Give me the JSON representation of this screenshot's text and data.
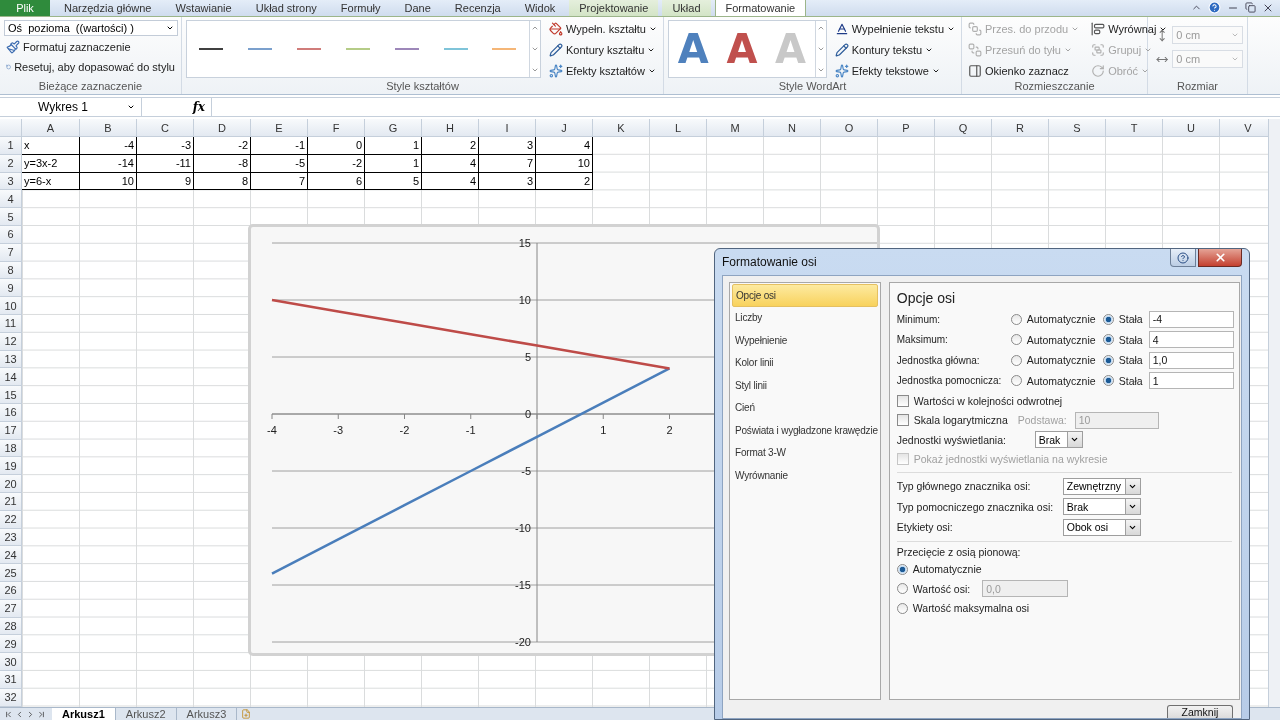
{
  "ribbon_tabs": [
    {
      "label": "Plik",
      "kind": "file",
      "selected": false
    },
    {
      "label": "Narzędzia główne",
      "kind": "normal",
      "selected": false
    },
    {
      "label": "Wstawianie",
      "kind": "normal",
      "selected": false
    },
    {
      "label": "Układ strony",
      "kind": "normal",
      "selected": false
    },
    {
      "label": "Formuły",
      "kind": "normal",
      "selected": false
    },
    {
      "label": "Dane",
      "kind": "normal",
      "selected": false
    },
    {
      "label": "Recenzja",
      "kind": "normal",
      "selected": false
    },
    {
      "label": "Widok",
      "kind": "normal",
      "selected": false
    },
    {
      "label": "Projektowanie",
      "kind": "contextual",
      "selected": false
    },
    {
      "label": "Układ",
      "kind": "contextual",
      "selected": false
    },
    {
      "label": "Formatowanie",
      "kind": "contextual",
      "selected": true
    }
  ],
  "ribbon": {
    "current_selection": {
      "label": "Bieżące zaznaczenie",
      "dropdown": "Oś  pozioma  ((wartości) )",
      "buttons": [
        {
          "label": "Formatuj zaznaczenie"
        },
        {
          "label": "Resetuj, aby dopasować do stylu"
        }
      ]
    },
    "shape_styles": {
      "label": "Style kształtów",
      "swatches": [
        {
          "color": "#404040"
        },
        {
          "color": "#7ba0cd"
        },
        {
          "color": "#d07c7a"
        },
        {
          "color": "#b5cc87"
        },
        {
          "color": "#9d87b9"
        },
        {
          "color": "#7fc4d9"
        },
        {
          "color": "#f5b677"
        }
      ],
      "buttons": [
        {
          "label": "Wypełn. kształtu",
          "menu": true
        },
        {
          "label": "Kontury kształtu",
          "menu": true
        },
        {
          "label": "Efekty kształtów",
          "menu": true
        }
      ]
    },
    "wordart": {
      "label": "Style WordArt",
      "styles": [
        {
          "letter": "A",
          "color": "#4f81bd"
        },
        {
          "letter": "A",
          "color": "#c0504d"
        },
        {
          "letter": "A",
          "color": "#c8c8c8"
        }
      ],
      "buttons": [
        {
          "label": "Wypełnienie tekstu",
          "menu": true
        },
        {
          "label": "Kontury tekstu",
          "menu": true
        },
        {
          "label": "Efekty tekstowe",
          "menu": true
        }
      ]
    },
    "arrange": {
      "label": "Rozmieszczanie",
      "columns": [
        [
          {
            "label": "Przes. do przodu",
            "disabled": true,
            "menu": true
          },
          {
            "label": "Przesuń do tyłu",
            "disabled": true,
            "menu": true
          },
          {
            "label": "Okienko zaznacz",
            "disabled": false,
            "menu": false
          }
        ],
        [
          {
            "label": "Wyrównaj",
            "disabled": false,
            "menu": true
          },
          {
            "label": "Grupuj",
            "disabled": true,
            "menu": true
          },
          {
            "label": "Obróć",
            "disabled": true,
            "menu": true
          }
        ]
      ]
    },
    "size": {
      "label": "Rozmiar",
      "fields": [
        {
          "value": "0 cm"
        },
        {
          "value": "0 cm"
        }
      ]
    }
  },
  "formula_bar": {
    "name_box": "Wykres 1",
    "function_label": "fx"
  },
  "sheet": {
    "columns": [
      "A",
      "B",
      "C",
      "D",
      "E",
      "F",
      "G",
      "H",
      "I",
      "J",
      "K",
      "L",
      "M",
      "N",
      "O",
      "P",
      "Q",
      "R",
      "S",
      "T",
      "U",
      "V"
    ],
    "rows": [
      {
        "header": "1",
        "cells": [
          "x",
          "-4",
          "-3",
          "-2",
          "-1",
          "0",
          "1",
          "2",
          "3",
          "4"
        ]
      },
      {
        "header": "2",
        "cells": [
          "y=3x-2",
          "-14",
          "-11",
          "-8",
          "-5",
          "-2",
          "1",
          "4",
          "7",
          "10"
        ]
      },
      {
        "header": "3",
        "cells": [
          "y=6-x",
          "10",
          "9",
          "8",
          "7",
          "6",
          "5",
          "4",
          "3",
          "2"
        ]
      },
      {
        "header": "4"
      },
      {
        "header": "5"
      },
      {
        "header": "6"
      },
      {
        "header": "7"
      },
      {
        "header": "8"
      },
      {
        "header": "9"
      },
      {
        "header": "10"
      },
      {
        "header": "11"
      },
      {
        "header": "12"
      },
      {
        "header": "13"
      },
      {
        "header": "14"
      },
      {
        "header": "15"
      },
      {
        "header": "16"
      },
      {
        "header": "17"
      },
      {
        "header": "18"
      },
      {
        "header": "19"
      },
      {
        "header": "20"
      },
      {
        "header": "21"
      },
      {
        "header": "22"
      },
      {
        "header": "23"
      },
      {
        "header": "24"
      },
      {
        "header": "25"
      },
      {
        "header": "26"
      },
      {
        "header": "27"
      },
      {
        "header": "28"
      },
      {
        "header": "29"
      },
      {
        "header": "30"
      },
      {
        "header": "31"
      },
      {
        "header": "32"
      }
    ],
    "chart": {
      "chart_data": {
        "type": "line",
        "x": [
          -4,
          -3,
          -2,
          -1,
          0,
          1,
          2
        ],
        "series": [
          {
            "color": "#4a7ebb",
            "values": [
              -14,
              -11,
              -8,
              -5,
              -2,
              1,
              4
            ]
          },
          {
            "color": "#be4b48",
            "values": [
              10,
              9,
              8,
              7,
              6,
              5,
              4
            ]
          }
        ],
        "grid": true,
        "xlim": [
          -4,
          4
        ],
        "ylim": [
          -20,
          15
        ],
        "xticks": [
          -4,
          -3,
          -2,
          -1,
          1,
          2
        ],
        "yticks": [
          -20,
          -15,
          -10,
          -5,
          0,
          5,
          10,
          15
        ]
      }
    }
  },
  "sheet_tabs": [
    {
      "label": "Arkusz1",
      "selected": true
    },
    {
      "label": "Arkusz2",
      "selected": false
    },
    {
      "label": "Arkusz3",
      "selected": false
    }
  ],
  "dialog": {
    "title": "Formatowanie osi",
    "categories": [
      {
        "label": "Opcje osi",
        "selected": true
      },
      {
        "label": "Liczby",
        "selected": false
      },
      {
        "label": "Wypełnienie",
        "selected": false
      },
      {
        "label": "Kolor linii",
        "selected": false
      },
      {
        "label": "Styl linii",
        "selected": false
      },
      {
        "label": "Cień",
        "selected": false
      },
      {
        "label": "Poświata i wygładzone krawędzie",
        "selected": false
      },
      {
        "label": "Format 3-W",
        "selected": false
      },
      {
        "label": "Wyrównanie",
        "selected": false
      }
    ],
    "heading": "Opcje osi",
    "bounds": [
      {
        "label": "Minimum:",
        "options": [
          {
            "label": "Automatycznie",
            "selected": false
          },
          {
            "label": "Stała",
            "selected": true
          }
        ],
        "value": "-4"
      },
      {
        "label": "Maksimum:",
        "options": [
          {
            "label": "Automatycznie",
            "selected": false
          },
          {
            "label": "Stała",
            "selected": true
          }
        ],
        "value": "4"
      },
      {
        "label": "Jednostka główna:",
        "options": [
          {
            "label": "Automatycznie",
            "selected": false
          },
          {
            "label": "Stała",
            "selected": true
          }
        ],
        "value": "1,0"
      },
      {
        "label": "Jednostka pomocnicza:",
        "options": [
          {
            "label": "Automatycznie",
            "selected": false
          },
          {
            "label": "Stała",
            "selected": true
          }
        ],
        "value": "1"
      }
    ],
    "reverse": {
      "label": "Wartości w kolejności odwrotnej",
      "checked": false
    },
    "log_scale": {
      "label": "Skala logarytmiczna",
      "checked": false,
      "base_label": "Podstawa:",
      "base_value": "10",
      "disabled": true
    },
    "display_units": {
      "label": "Jednostki wyświetlania:",
      "value": "Brak"
    },
    "show_units": {
      "label": "Pokaż jednostki wyświetlania na wykresie",
      "checked": false,
      "disabled": true
    },
    "tick_settings": [
      {
        "label": "Typ głównego znacznika osi:",
        "value": "Zewnętrzny"
      },
      {
        "label": "Typ pomocniczego znacznika osi:",
        "value": "Brak"
      },
      {
        "label": "Etykiety osi:",
        "value": "Obok osi"
      }
    ],
    "crossing": {
      "label": "Przecięcie z osią pionową:",
      "options": [
        {
          "label": "Automatycznie",
          "selected": true
        },
        {
          "label": "Wartość osi:",
          "selected": false,
          "value": "0,0",
          "disabled": true
        },
        {
          "label": "Wartość maksymalna osi",
          "selected": false
        }
      ]
    },
    "close_button": "Zamknij"
  }
}
